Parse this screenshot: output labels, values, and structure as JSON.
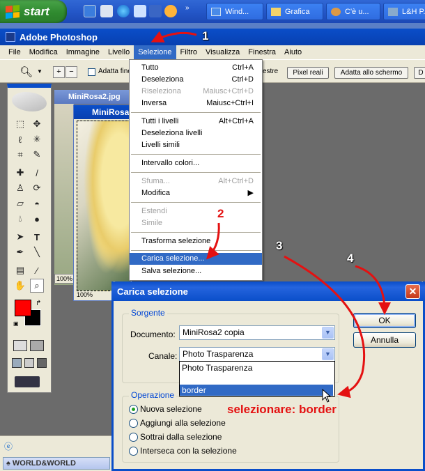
{
  "taskbar": {
    "start_label": "start",
    "buttons": [
      {
        "label": "Wind..."
      },
      {
        "label": "Grafica"
      },
      {
        "label": "C'è u..."
      },
      {
        "label": "L&H P..."
      }
    ]
  },
  "app": {
    "title": "Adobe Photoshop",
    "menu": [
      "File",
      "Modifica",
      "Immagine",
      "Livello",
      "Selezione",
      "Filtro",
      "Visualizza",
      "Finestra",
      "Aiuto"
    ]
  },
  "options_bar": {
    "fit_windows_label": "Adatta fine",
    "tail_label": "estre",
    "actual_pixels": "Pixel reali",
    "fit_screen": "Adatta allo schermo"
  },
  "documents": {
    "doc1_title": "MiniRosa2.jpg",
    "doc2_title": "MiniRosa",
    "zoom1": "100%",
    "zoom2": "100%"
  },
  "selezione_menu": {
    "items": [
      {
        "label": "Tutto",
        "shortcut": "Ctrl+A",
        "disabled": false
      },
      {
        "label": "Deseleziona",
        "shortcut": "Ctrl+D",
        "disabled": false
      },
      {
        "label": "Riseleziona",
        "shortcut": "Maiusc+Ctrl+D",
        "disabled": true
      },
      {
        "label": "Inversa",
        "shortcut": "Maiusc+Ctrl+I",
        "disabled": false
      },
      {
        "label": "Tutti i livelli",
        "shortcut": "Alt+Ctrl+A",
        "disabled": false
      },
      {
        "label": "Deseleziona livelli",
        "shortcut": "",
        "disabled": false
      },
      {
        "label": "Livelli simili",
        "shortcut": "",
        "disabled": false
      },
      {
        "label": "Intervallo colori...",
        "shortcut": "",
        "disabled": false
      },
      {
        "label": "Sfuma...",
        "shortcut": "Alt+Ctrl+D",
        "disabled": true
      },
      {
        "label": "Modifica",
        "shortcut": "",
        "disabled": false
      },
      {
        "label": "Estendi",
        "shortcut": "",
        "disabled": true
      },
      {
        "label": "Simile",
        "shortcut": "",
        "disabled": true
      },
      {
        "label": "Trasforma selezione",
        "shortcut": "",
        "disabled": false
      },
      {
        "label": "Carica selezione...",
        "shortcut": "",
        "disabled": false,
        "highlighted": true
      },
      {
        "label": "Salva selezione...",
        "shortcut": "",
        "disabled": false
      }
    ]
  },
  "dialog": {
    "title": "Carica selezione",
    "source_group": "Sorgente",
    "document_label": "Documento:",
    "document_value": "MiniRosa2 copia",
    "channel_label": "Canale:",
    "channel_value": "Photo Trasparenza",
    "channel_options": [
      "Photo Trasparenza",
      "",
      "border"
    ],
    "ok": "OK",
    "cancel": "Annulla",
    "operation_group": "Operazione",
    "operations": [
      "Nuova selezione",
      "Aggiungi alla selezione",
      "Sottrai dalla selezione",
      "Interseca con la selezione"
    ]
  },
  "annotations": {
    "step1": "1",
    "step2": "2",
    "step3": "3",
    "step4": "4",
    "note": "selezionare: border",
    "arrow_color": "#e41111"
  },
  "bottom": {
    "panel_label": "WORLD&WORLD"
  }
}
